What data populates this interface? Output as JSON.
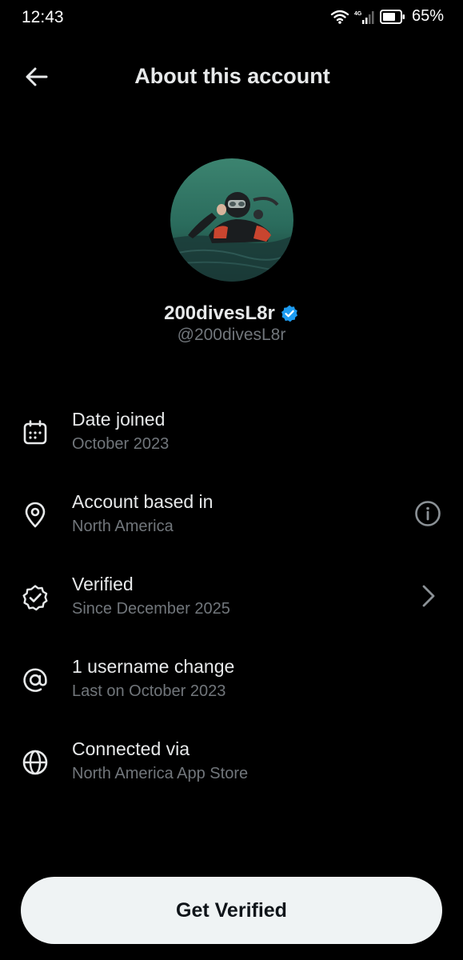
{
  "status_bar": {
    "time": "12:43",
    "battery": "65%",
    "network": "4G"
  },
  "header": {
    "title": "About this account",
    "back_icon": "arrow-left-icon"
  },
  "profile": {
    "display_name": "200divesL8r",
    "handle": "@200divesL8r",
    "verified": true
  },
  "rows": [
    {
      "icon": "calendar-icon",
      "title": "Date joined",
      "subtitle": "October 2023"
    },
    {
      "icon": "location-pin-icon",
      "title": "Account based in",
      "subtitle": "North America",
      "action_icon": "info-icon"
    },
    {
      "icon": "verified-badge-outline-icon",
      "title": "Verified",
      "subtitle": "Since December 2025",
      "action_icon": "chevron-right-icon"
    },
    {
      "icon": "at-sign-icon",
      "title": "1 username change",
      "subtitle": "Last on October 2023"
    },
    {
      "icon": "globe-icon",
      "title": "Connected via",
      "subtitle": "North America App Store"
    }
  ],
  "cta": {
    "label": "Get Verified"
  },
  "colors": {
    "background": "#000000",
    "primary_text": "#e7e9ea",
    "secondary_text": "#71767b",
    "verified_blue": "#1d9bf0",
    "button_bg": "#eff3f4"
  }
}
